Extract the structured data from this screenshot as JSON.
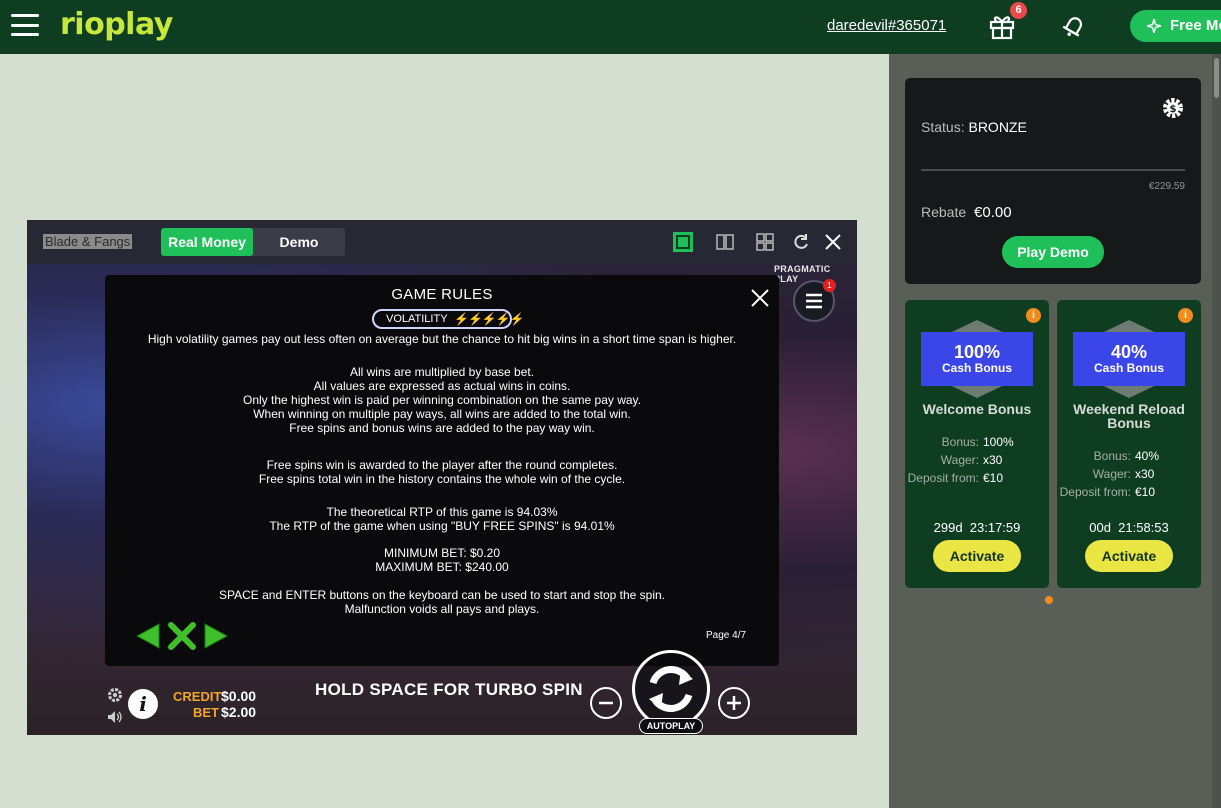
{
  "header": {
    "logo": "rioplay",
    "username": "daredevil#365071",
    "gift_badge": "6",
    "free_button": "Free Mo",
    "accent": "#1fbf5a"
  },
  "game": {
    "title": "Blade & Fangs",
    "tabs": {
      "real": "Real Money",
      "demo": "Demo"
    },
    "provider": "PRAGMATIC PLAY",
    "menu_badge": "1",
    "rules": {
      "title": "GAME RULES",
      "volatility_label": "VOLATILITY",
      "volatility_level": 5,
      "volatility_glyphs": "⚡⚡⚡⚡⚡",
      "paragraphs": [
        [
          "High volatility games pay out less often on average but the chance to hit big wins in a short time span is higher."
        ],
        [
          "All wins are multiplied by base bet.",
          "All values are expressed as actual wins in coins.",
          "Only the highest win is paid per winning combination on the same pay way.",
          "When winning on multiple pay ways, all wins are added to the total win.",
          "Free spins and bonus wins are added to the pay way win."
        ],
        [
          "Free spins win is awarded to the player after the round completes.",
          "Free spins total win in the history contains the whole win of the cycle."
        ],
        [
          "The theoretical RTP of this game is 94.03%",
          "The RTP of the game when using \"BUY FREE SPINS\" is 94.01%"
        ],
        [
          "MINIMUM BET: $0.20",
          "MAXIMUM BET: $240.00"
        ],
        [
          "SPACE and ENTER buttons on the keyboard can be used to start and stop the spin.",
          "Malfunction voids all pays and plays."
        ]
      ],
      "page": "Page 4/7"
    },
    "controls": {
      "credit_label": "CREDIT",
      "credit_value": "$0.00",
      "bet_label": "BET",
      "bet_value": "$2.00",
      "message": "HOLD SPACE FOR TURBO SPIN",
      "autoplay": "AUTOPLAY",
      "info": "i"
    }
  },
  "status_card": {
    "status_label": "Status:",
    "status_value": "BRONZE",
    "progress_amount": "€229.59",
    "rebate_label": "Rebate",
    "rebate_value": "€0.00",
    "play_demo": "Play Demo"
  },
  "bonuses": [
    {
      "pct": "100%",
      "sub": "Cash Bonus",
      "name": "Welcome Bonus",
      "rows": [
        {
          "k": "Bonus:",
          "v": "100%"
        },
        {
          "k": "Wager:",
          "v": "x30"
        },
        {
          "k": "Deposit from:",
          "v": "€10"
        }
      ],
      "timer": "299d  23:17:59",
      "button": "Activate"
    },
    {
      "pct": "40%",
      "sub": "Cash Bonus",
      "name": "Weekend Reload Bonus",
      "rows": [
        {
          "k": "Bonus:",
          "v": "40%"
        },
        {
          "k": "Wager:",
          "v": "x30"
        },
        {
          "k": "Deposit from:",
          "v": "€10"
        }
      ],
      "timer": "00d  21:58:53",
      "button": "Activate"
    }
  ]
}
